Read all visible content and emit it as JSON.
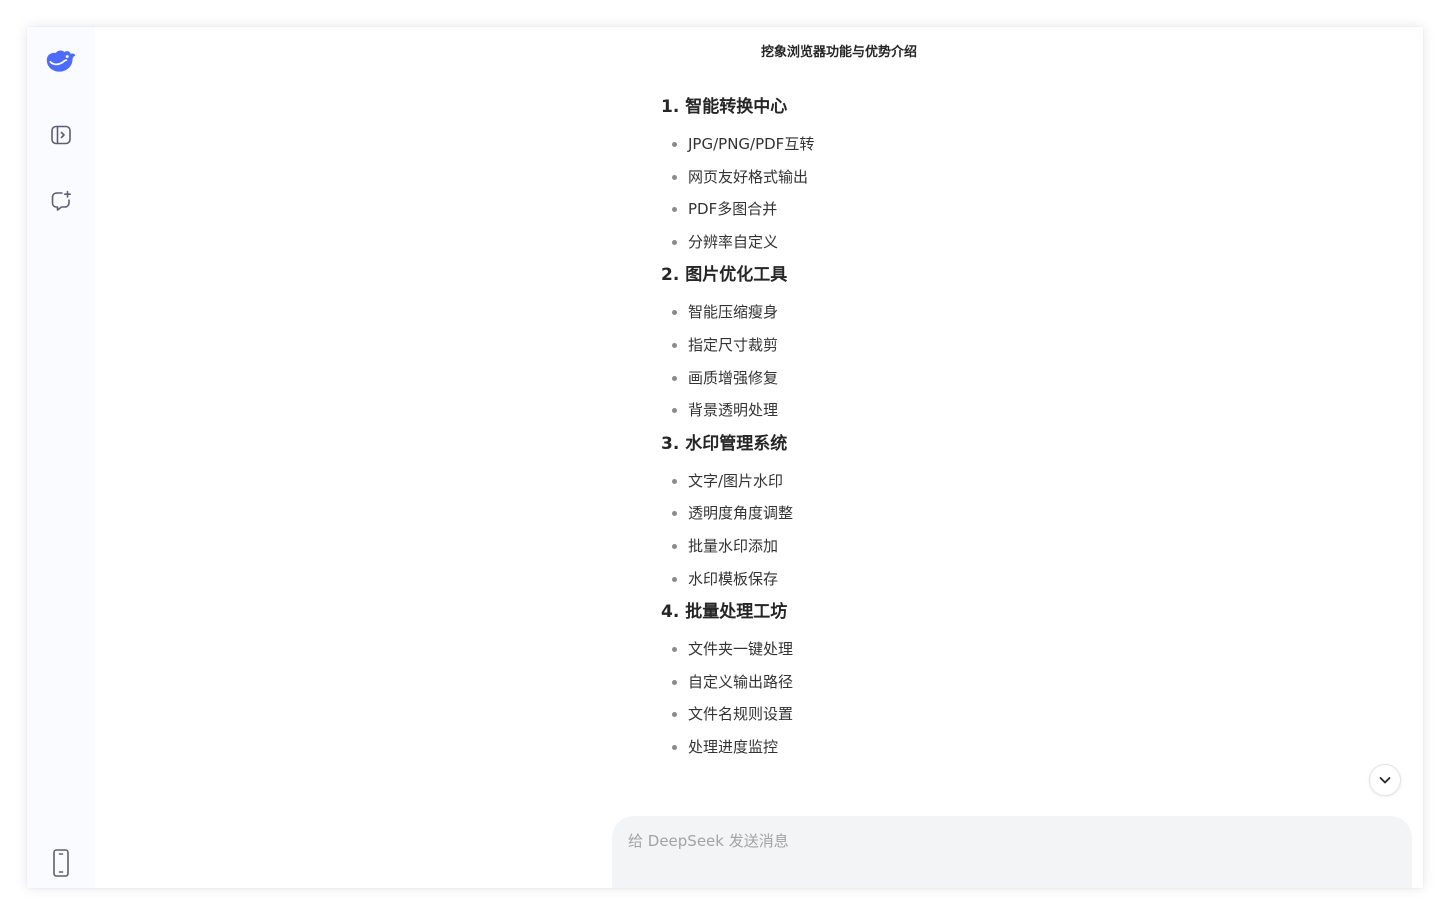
{
  "app": {
    "conversation_title": "挖象浏览器功能与优势介绍"
  },
  "sidebar": {
    "logo_icon": "deepseek-whale-logo",
    "toggle_icon": "sidebar-toggle-icon",
    "new_chat_icon": "new-chat-icon",
    "mobile_icon": "mobile-phone-icon",
    "accent_color": "#4d6bfe"
  },
  "sections": [
    {
      "heading": "1. 智能转换中心",
      "items": [
        "JPG/PNG/PDF互转",
        "网页友好格式输出",
        "PDF多图合并",
        "分辨率自定义"
      ]
    },
    {
      "heading": "2. 图片优化工具",
      "items": [
        "智能压缩瘦身",
        "指定尺寸裁剪",
        "画质增强修复",
        "背景透明处理"
      ]
    },
    {
      "heading": "3. 水印管理系统",
      "items": [
        "文字/图片水印",
        "透明度角度调整",
        "批量水印添加",
        "水印模板保存"
      ]
    },
    {
      "heading": "4. 批量处理工坊",
      "items": [
        "文件夹一键处理",
        "自定义输出路径",
        "文件名规则设置",
        "处理进度监控"
      ]
    }
  ],
  "composer": {
    "placeholder": "给 DeepSeek 发送消息",
    "value": ""
  },
  "scroll_down_icon": "chevron-down-icon"
}
